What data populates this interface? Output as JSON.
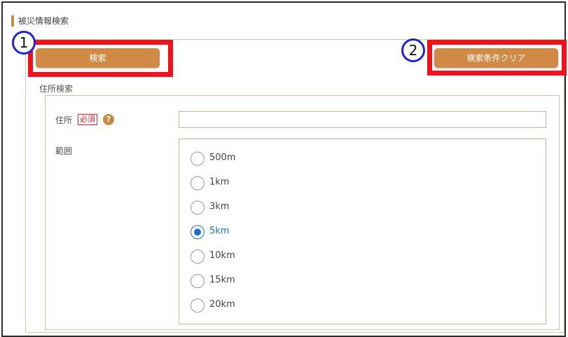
{
  "page": {
    "title": "被災情報検索"
  },
  "buttons": {
    "search_label": "検索",
    "clear_label": "検索条件クリア"
  },
  "annotations": {
    "marker_1": "1",
    "marker_2": "2",
    "highlight_color": "#f0101e",
    "marker_color": "#1e25d8"
  },
  "address_search": {
    "section_label": "住所検索",
    "address_label": "住所",
    "required_badge": "必須",
    "help_icon": "question-circle-icon",
    "address_value": "",
    "range_label": "範囲",
    "selected_range": "5km",
    "range_options": [
      "500m",
      "1km",
      "3km",
      "5km",
      "10km",
      "15km",
      "20km"
    ]
  },
  "colors": {
    "accent": "#d18a45",
    "radio_selected": "#1f6fd1"
  }
}
